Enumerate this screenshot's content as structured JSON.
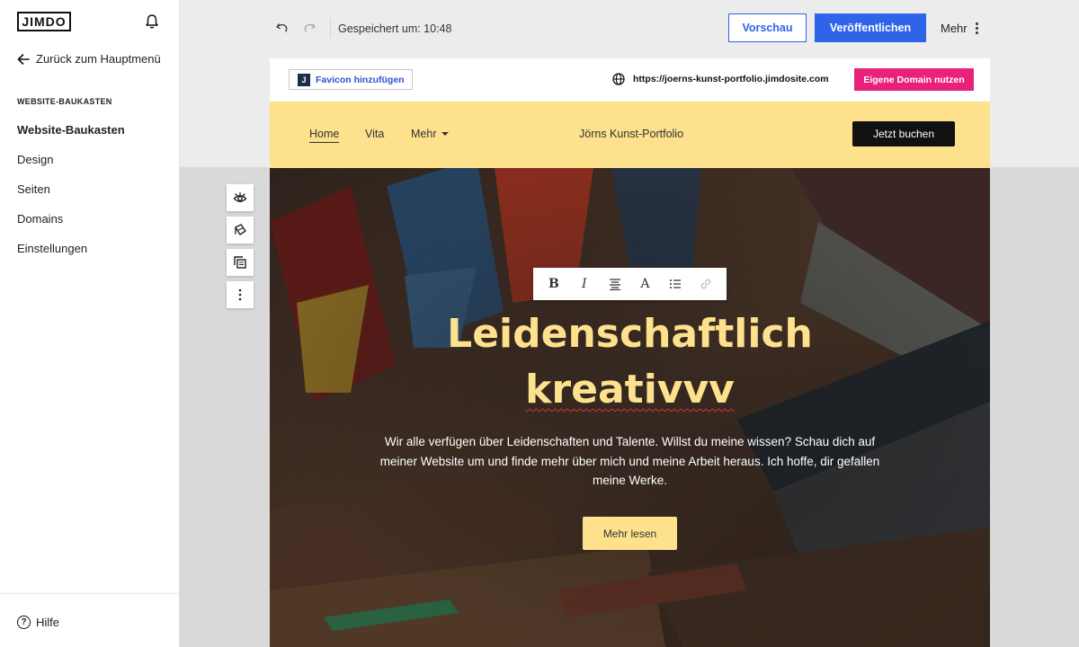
{
  "sidebar": {
    "logo": "JIMDO",
    "back_label": "Zurück zum Hauptmenü",
    "section_title": "WEBSITE-BAUKASTEN",
    "items": [
      {
        "label": "Website-Baukasten",
        "active": true
      },
      {
        "label": "Design"
      },
      {
        "label": "Seiten"
      },
      {
        "label": "Domains"
      },
      {
        "label": "Einstellungen"
      }
    ],
    "help_label": "Hilfe"
  },
  "topbar": {
    "saved_text": "Gespeichert um: 10:48",
    "preview_label": "Vorschau",
    "publish_label": "Veröffentlichen",
    "more_label": "Mehr"
  },
  "site": {
    "favicon_label": "Favicon hinzufügen",
    "url": "https://joerns-kunst-portfolio.jimdosite.com",
    "domain_button": "Eigene Domain nutzen",
    "nav": {
      "home": "Home",
      "vita": "Vita",
      "mehr": "Mehr",
      "title": "Jörns Kunst-Portfolio",
      "cta": "Jetzt buchen"
    },
    "hero": {
      "headline_line1": "Leidenschaftlich",
      "headline_line2": "kreativvv",
      "lead": "Wir alle verfügen über Leidenschaften und Talente. Willst du meine wissen? Schau dich auf meiner Website um und finde mehr über mich und meine Arbeit heraus. Ich hoffe, dir gefallen meine Werke.",
      "button": "Mehr lesen"
    }
  },
  "colors": {
    "accent_blue": "#2f63e8",
    "nav_yellow": "#fde18d",
    "domain_pink": "#e8217a"
  }
}
